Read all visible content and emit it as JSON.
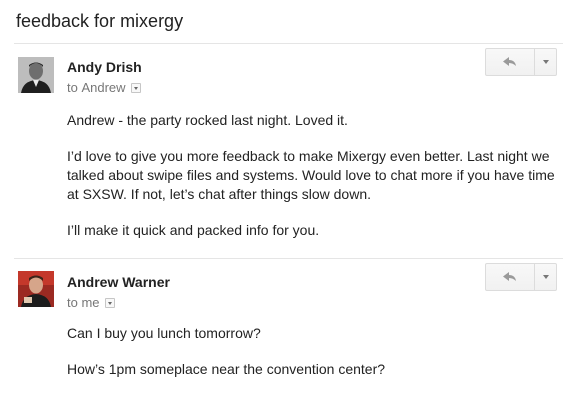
{
  "subject": "feedback for mixergy",
  "messages": [
    {
      "sender": "Andy Drish",
      "recipient_prefix": "to",
      "recipient": "Andrew",
      "paragraphs": [
        "Andrew - the party rocked last night. Loved it.",
        "I’d love to give you more feedback to make Mixergy even better. Last night we talked about swipe files and systems. Would love to chat more if you have time at SXSW. If not, let’s chat after things slow down.",
        "I’ll make it quick and packed info for you."
      ],
      "reply_icon": "reply-arrow-icon",
      "more_icon": "chevron-down-icon"
    },
    {
      "sender": "Andrew Warner",
      "recipient_prefix": "to",
      "recipient": "me",
      "paragraphs": [
        "Can I buy you lunch tomorrow?",
        "How’s 1pm someplace near the convention center?"
      ],
      "reply_icon": "reply-arrow-icon",
      "more_icon": "chevron-down-icon"
    }
  ]
}
